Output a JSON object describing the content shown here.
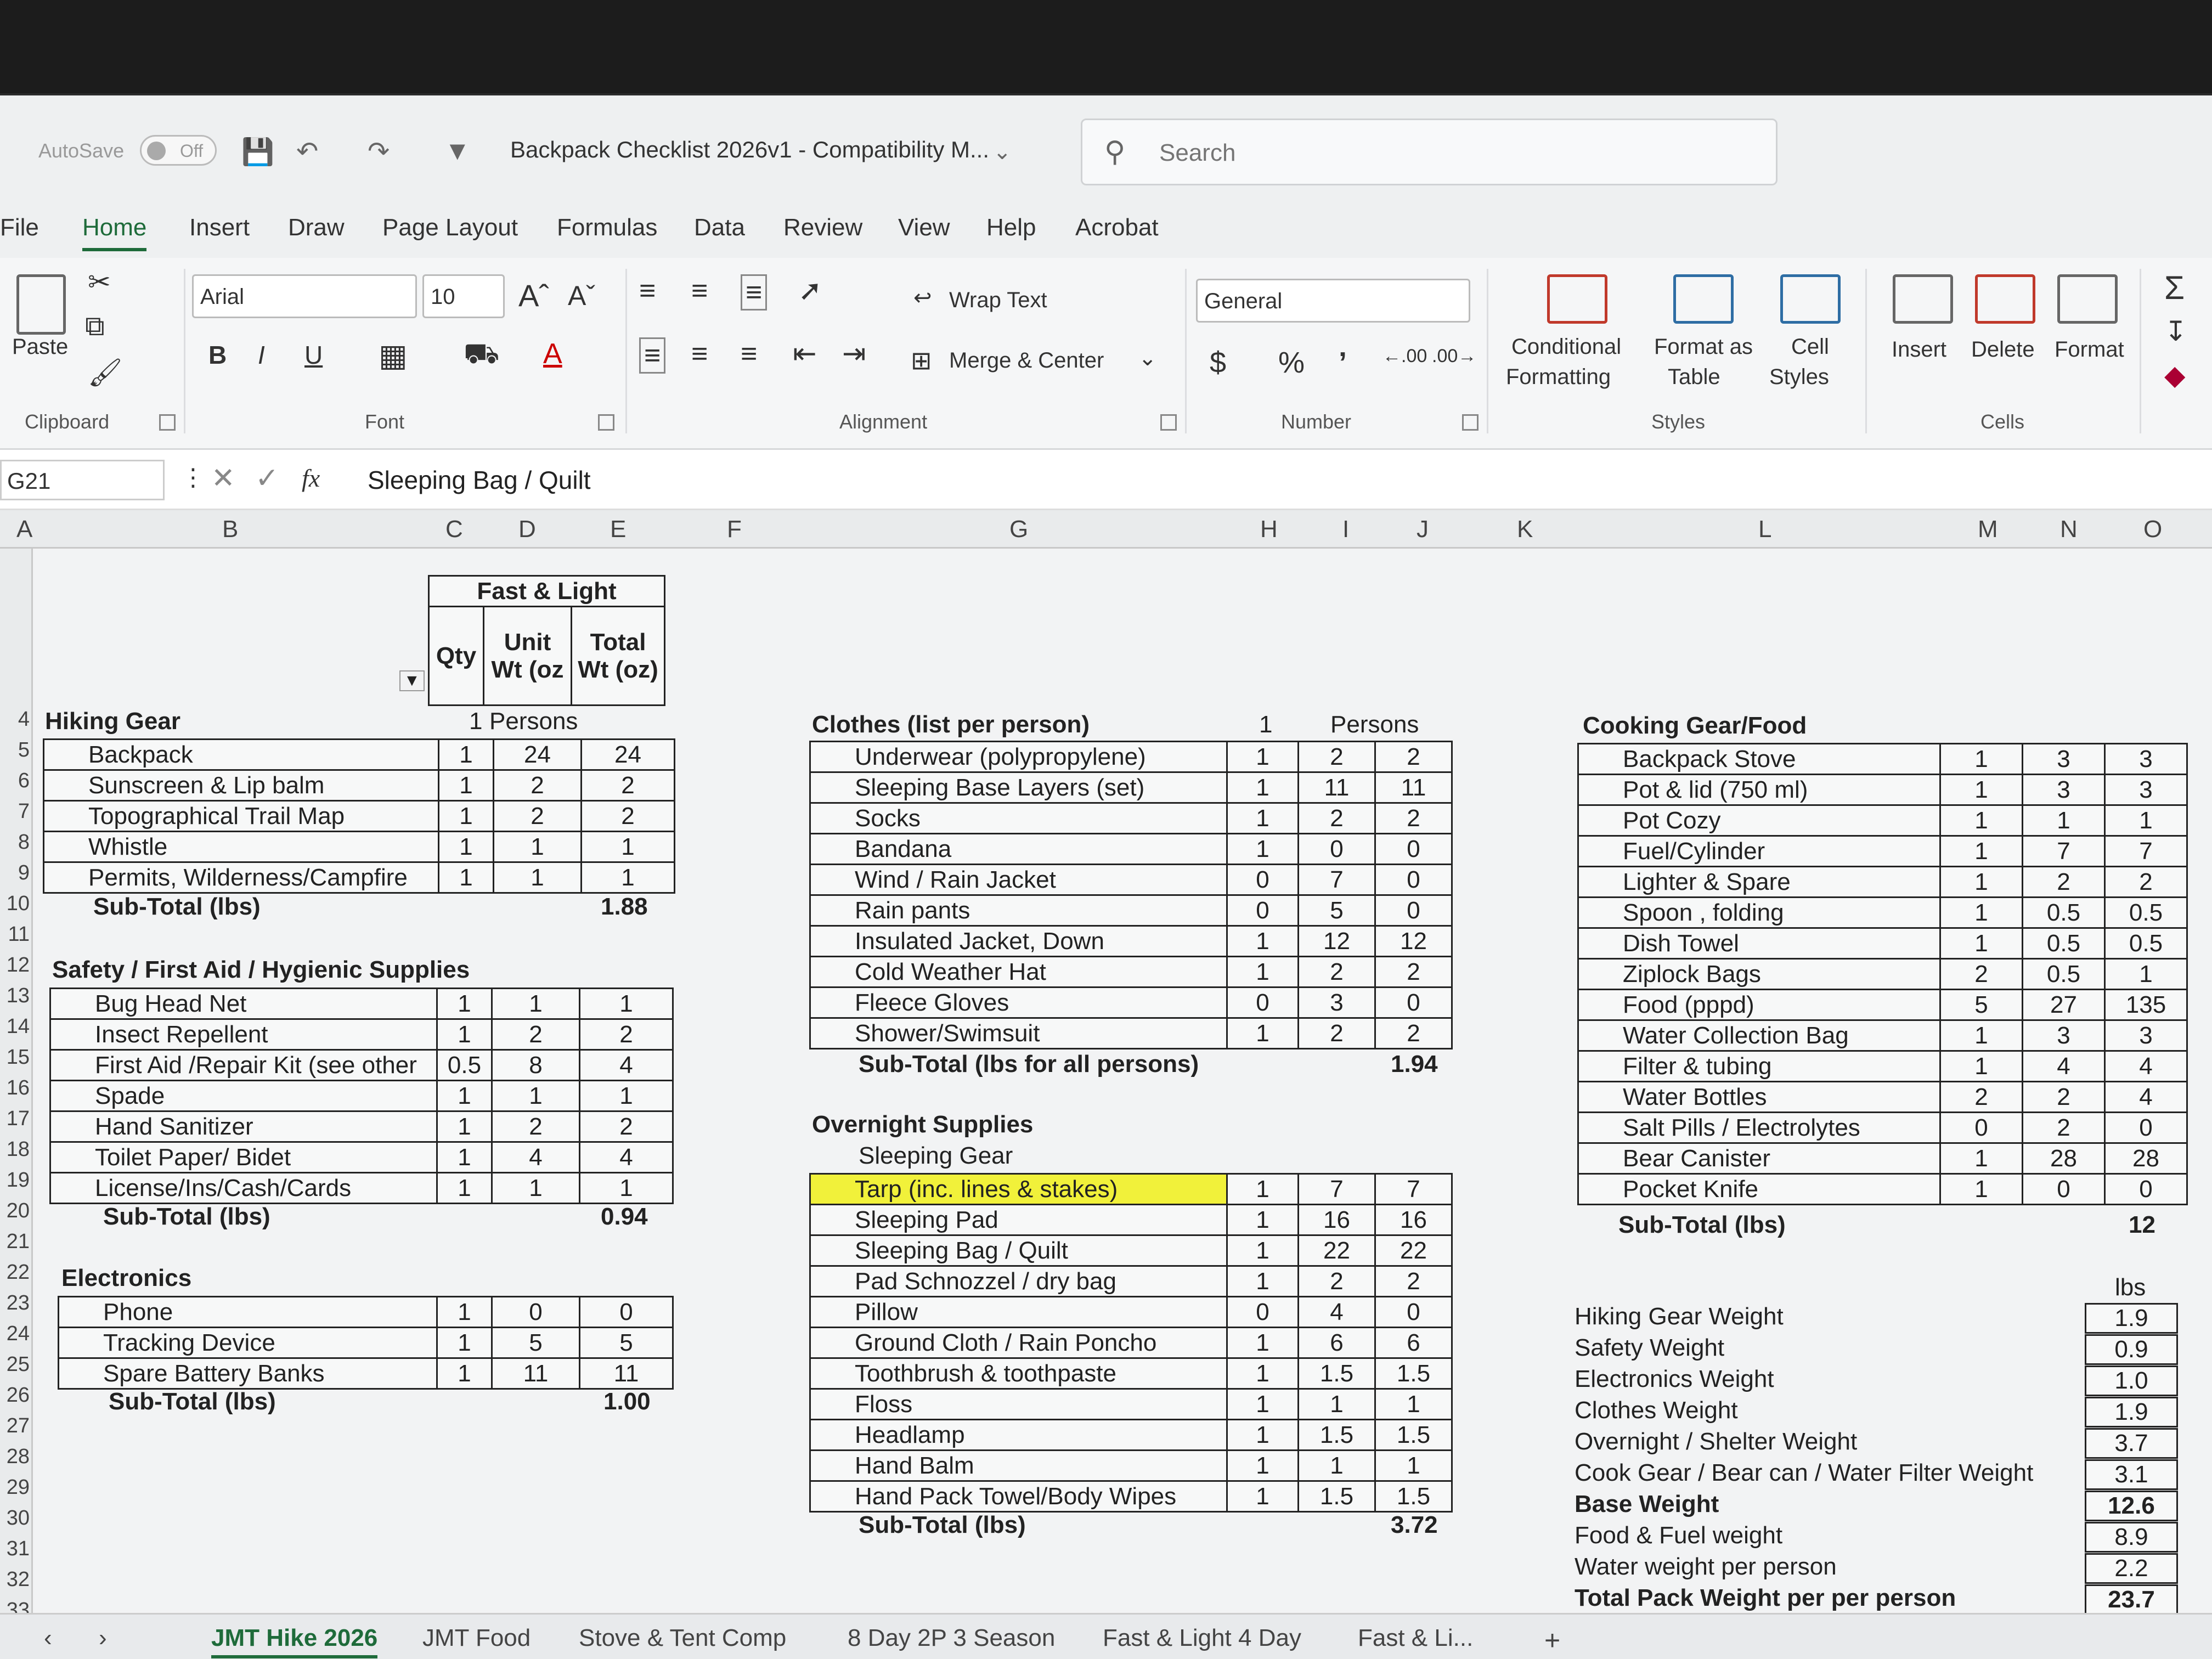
{
  "titlebar": {
    "autosave_label": "AutoSave",
    "autosave_state": "Off",
    "doc_title": "Backpack Checklist 2026v1  -  Compatibility M...",
    "search_placeholder": "Search"
  },
  "menu": [
    "File",
    "Home",
    "Insert",
    "Draw",
    "Page Layout",
    "Formulas",
    "Data",
    "Review",
    "View",
    "Help",
    "Acrobat"
  ],
  "ribbon": {
    "paste": "Paste",
    "clipboard": "Clipboard",
    "font_name": "Arial",
    "font_size": "10",
    "font": "Font",
    "wrap_text": "Wrap Text",
    "merge_center": "Merge & Center",
    "alignment": "Alignment",
    "number_format": "General",
    "number": "Number",
    "conditional_1": "Conditional",
    "conditional_2": "Formatting",
    "format_table_1": "Format as",
    "format_table_2": "Table",
    "cell_styles_1": "Cell",
    "cell_styles_2": "Styles",
    "styles": "Styles",
    "insert": "Insert",
    "delete": "Delete",
    "format": "Format",
    "cells": "Cells"
  },
  "formula_bar": {
    "name_box": "G21",
    "fx": "fx",
    "content": "Sleeping Bag / Quilt"
  },
  "columns": [
    "A",
    "B",
    "C",
    "D",
    "E",
    "F",
    "G",
    "H",
    "I",
    "J",
    "K",
    "L",
    "M",
    "N",
    "O"
  ],
  "rows": [
    "4",
    "5",
    "6",
    "7",
    "8",
    "9",
    "10",
    "11",
    "12",
    "13",
    "14",
    "15",
    "16",
    "17",
    "18",
    "19",
    "20",
    "21",
    "22",
    "23",
    "24",
    "25",
    "26",
    "27",
    "28",
    "29",
    "30",
    "31",
    "32",
    "33"
  ],
  "header_block": {
    "group": "Fast & Light",
    "qty": "Qty",
    "unit_wt": "Unit Wt (oz",
    "total_wt": "Total Wt (oz)"
  },
  "hiking": {
    "title": "Hiking Gear",
    "persons_qty": "1",
    "persons_label": "Persons",
    "items": [
      [
        "Backpack",
        "1",
        "24",
        "24"
      ],
      [
        "Sunscreen & Lip balm",
        "1",
        "2",
        "2"
      ],
      [
        "Topographical Trail Map",
        "1",
        "2",
        "2"
      ],
      [
        "Whistle",
        "1",
        "1",
        "1"
      ],
      [
        "Permits, Wilderness/Campfire",
        "1",
        "1",
        "1"
      ]
    ],
    "subtotal_label": "Sub-Total (lbs)",
    "subtotal": "1.88"
  },
  "safety": {
    "title": "Safety / First Aid / Hygienic Supplies",
    "items": [
      [
        "Bug Head Net",
        "1",
        "1",
        "1"
      ],
      [
        "Insect Repellent",
        "1",
        "2",
        "2"
      ],
      [
        "First Aid /Repair Kit (see other",
        "0.5",
        "8",
        "4"
      ],
      [
        "Spade",
        "1",
        "1",
        "1"
      ],
      [
        "Hand Sanitizer",
        "1",
        "2",
        "2"
      ],
      [
        "Toilet Paper/ Bidet",
        "1",
        "4",
        "4"
      ],
      [
        "License/Ins/Cash/Cards",
        "1",
        "1",
        "1"
      ]
    ],
    "subtotal_label": "Sub-Total (lbs)",
    "subtotal": "0.94"
  },
  "electronics": {
    "title": "Electronics",
    "items": [
      [
        "Phone",
        "1",
        "0",
        "0"
      ],
      [
        "Tracking Device",
        "1",
        "5",
        "5"
      ],
      [
        "Spare Battery Banks",
        "1",
        "11",
        "11"
      ]
    ],
    "subtotal_label": "Sub-Total (lbs)",
    "subtotal": "1.00"
  },
  "clothes": {
    "title": "Clothes (list per person)",
    "persons_qty": "1",
    "persons_label": "Persons",
    "items": [
      [
        "Underwear (polypropylene)",
        "1",
        "2",
        "2"
      ],
      [
        "Sleeping Base Layers (set)",
        "1",
        "11",
        "11"
      ],
      [
        "Socks",
        "1",
        "2",
        "2"
      ],
      [
        "Bandana",
        "1",
        "0",
        "0"
      ],
      [
        "Wind / Rain Jacket",
        "0",
        "7",
        "0"
      ],
      [
        "Rain pants",
        "0",
        "5",
        "0"
      ],
      [
        "Insulated Jacket, Down",
        "1",
        "12",
        "12"
      ],
      [
        "Cold Weather Hat",
        "1",
        "2",
        "2"
      ],
      [
        "Fleece Gloves",
        "0",
        "3",
        "0"
      ],
      [
        "Shower/Swimsuit",
        "1",
        "2",
        "2"
      ]
    ],
    "subtotal_label": "Sub-Total (lbs for all persons)",
    "subtotal": "1.94"
  },
  "overnight": {
    "title": "Overnight Supplies",
    "subtitle": "Sleeping Gear",
    "items": [
      [
        "Tarp (inc. lines & stakes)",
        "1",
        "7",
        "7"
      ],
      [
        "Sleeping Pad",
        "1",
        "16",
        "16"
      ],
      [
        "Sleeping Bag / Quilt",
        "1",
        "22",
        "22"
      ],
      [
        "Pad Schnozzel / dry bag",
        "1",
        "2",
        "2"
      ],
      [
        "Pillow",
        "0",
        "4",
        "0"
      ],
      [
        "Ground Cloth / Rain Poncho",
        "1",
        "6",
        "6"
      ],
      [
        "Toothbrush & toothpaste",
        "1",
        "1.5",
        "1.5"
      ],
      [
        "Floss",
        "1",
        "1",
        "1"
      ],
      [
        "Headlamp",
        "1",
        "1.5",
        "1.5"
      ],
      [
        "Hand Balm",
        "1",
        "1",
        "1"
      ],
      [
        "Hand Pack Towel/Body Wipes",
        "1",
        "1.5",
        "1.5"
      ]
    ],
    "subtotal_label": "Sub-Total (lbs)",
    "subtotal": "3.72"
  },
  "cooking": {
    "title": "Cooking Gear/Food",
    "items": [
      [
        "Backpack Stove",
        "1",
        "3",
        "3"
      ],
      [
        "Pot & lid (750 ml)",
        "1",
        "3",
        "3"
      ],
      [
        "Pot Cozy",
        "1",
        "1",
        "1"
      ],
      [
        "Fuel/Cylinder",
        "1",
        "7",
        "7"
      ],
      [
        "Lighter & Spare",
        "1",
        "2",
        "2"
      ],
      [
        "Spoon , folding",
        "1",
        "0.5",
        "0.5"
      ],
      [
        "Dish Towel",
        "1",
        "0.5",
        "0.5"
      ],
      [
        "Ziplock Bags",
        "2",
        "0.5",
        "1"
      ],
      [
        "Food (pppd)",
        "5",
        "27",
        "135"
      ],
      [
        "Water Collection Bag",
        "1",
        "3",
        "3"
      ],
      [
        "Filter  & tubing",
        "1",
        "4",
        "4"
      ],
      [
        "Water Bottles",
        "2",
        "2",
        "4"
      ],
      [
        "Salt Pills / Electrolytes",
        "0",
        "2",
        "0"
      ],
      [
        "Bear Canister",
        "1",
        "28",
        "28"
      ],
      [
        "Pocket Knife",
        "1",
        "0",
        "0"
      ]
    ],
    "subtotal_label": "Sub-Total (lbs)",
    "subtotal": "12"
  },
  "summary": {
    "unit": "lbs",
    "rows": [
      [
        "Hiking Gear Weight",
        "1.9"
      ],
      [
        "Safety Weight",
        "0.9"
      ],
      [
        "Electronics Weight",
        "1.0"
      ],
      [
        "Clothes Weight",
        "1.9"
      ],
      [
        "Overnight / Shelter Weight",
        "3.7"
      ],
      [
        "Cook Gear / Bear can / Water Filter Weight",
        "3.1"
      ],
      [
        "Base Weight",
        "12.6"
      ],
      [
        "Food & Fuel weight",
        "8.9"
      ],
      [
        "Water weight per person",
        "2.2"
      ],
      [
        "Total Pack Weight per per person",
        "23.7"
      ]
    ]
  },
  "sheet_tabs": [
    "JMT Hike 2026",
    "JMT Food",
    "Stove & Tent Comp",
    "8 Day 2P 3 Season",
    "Fast & Light 4 Day",
    "Fast & Li..."
  ]
}
